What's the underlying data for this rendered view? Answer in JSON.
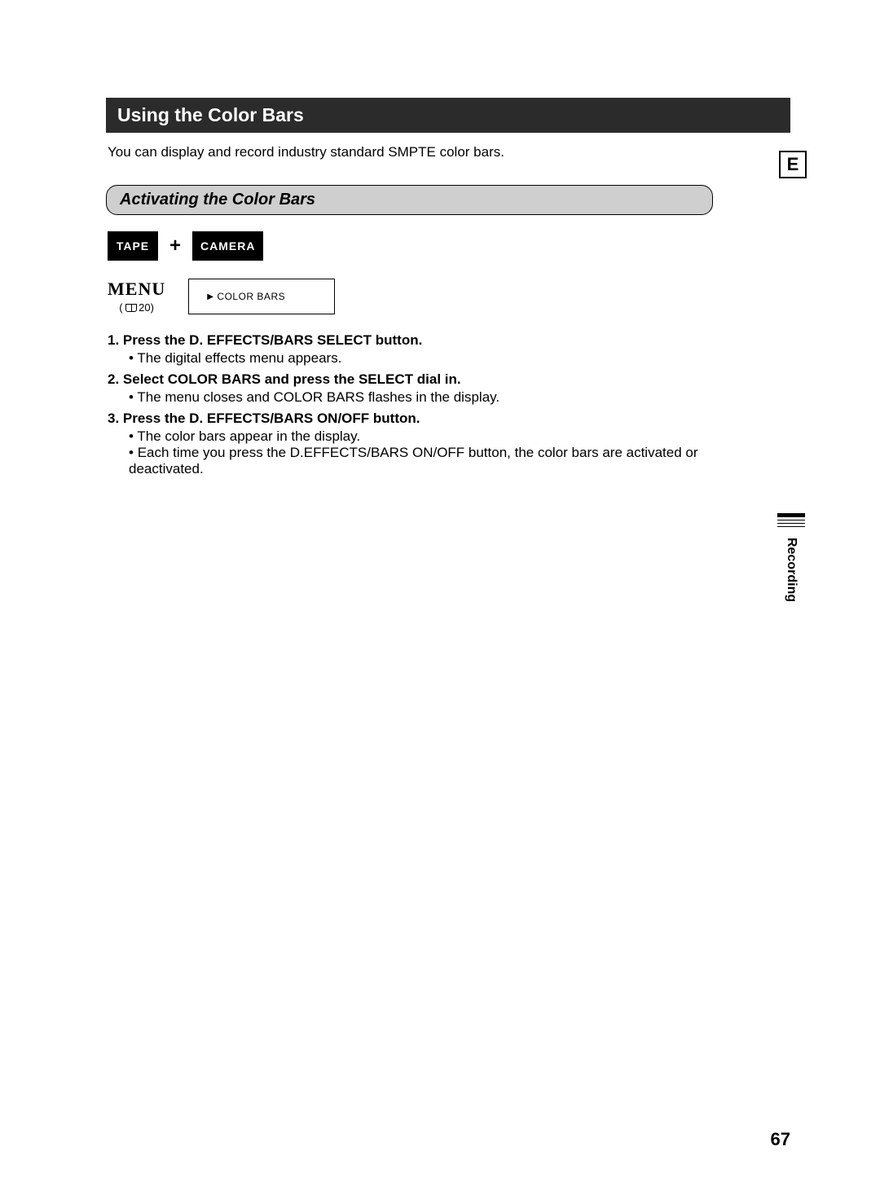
{
  "title": "Using the Color Bars",
  "intro": "You can display and record industry standard SMPTE color bars.",
  "langBadge": "E",
  "sectionHeader": "Activating the Color Bars",
  "mode": {
    "tape": "TAPE",
    "plus": "+",
    "camera": "CAMERA"
  },
  "menu": {
    "label": "MENU",
    "ref": "20",
    "item": "COLOR BARS"
  },
  "steps": [
    {
      "title": "1. Press the D. EFFECTS/BARS SELECT button.",
      "bullets": [
        "The digital effects menu appears."
      ]
    },
    {
      "title": "2. Select COLOR BARS and press the SELECT dial in.",
      "bullets": [
        "The menu closes and COLOR BARS flashes in the display."
      ]
    },
    {
      "title": "3. Press the D. EFFECTS/BARS ON/OFF button.",
      "bullets": [
        "The color bars appear in the display.",
        "Each time you press the D.EFFECTS/BARS ON/OFF button, the color bars are activated or deactivated."
      ]
    }
  ],
  "sideLabel": "Recording",
  "pageNumber": "67"
}
